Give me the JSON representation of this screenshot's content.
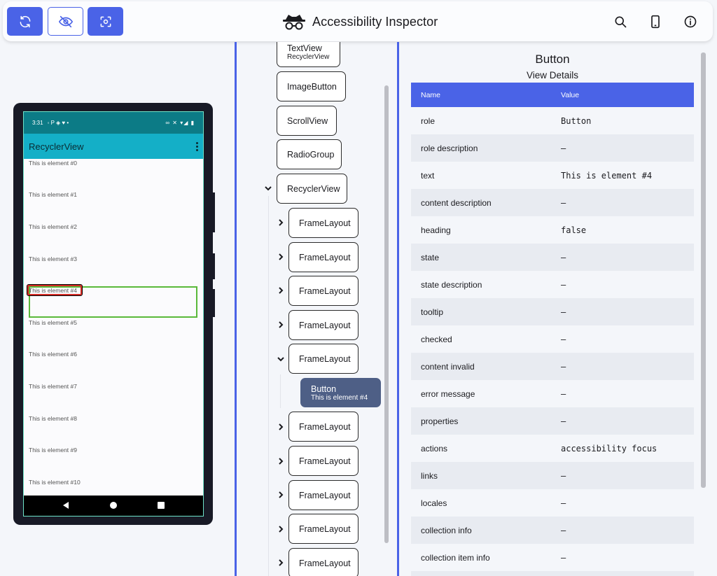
{
  "toolbar": {
    "title": "Accessibility Inspector",
    "buttons": [
      {
        "name": "refresh",
        "icon": "refresh-icon"
      },
      {
        "name": "toggle-visibility",
        "icon": "eye-off-icon"
      },
      {
        "name": "screenshot",
        "icon": "focus-capture-icon"
      }
    ],
    "right_icons": [
      "search-icon",
      "phone-icon",
      "info-icon"
    ],
    "accent": "#4a63e7"
  },
  "device": {
    "status_time": "3:31",
    "app_title": "RecyclerView",
    "elements": [
      "This is element #0",
      "This is element #1",
      "This is element #2",
      "This is element #3",
      "This is element #4",
      "This is element #5",
      "This is element #6",
      "This is element #7",
      "This is element #8",
      "This is element #9",
      "This is element #10"
    ],
    "statusbar_color": "#0c7b86",
    "appbar_color": "#14afc7"
  },
  "tree": {
    "nodes": [
      {
        "label": "TextView",
        "sub": "RecyclerView"
      },
      {
        "label": "ImageButton"
      },
      {
        "label": "ScrollView"
      },
      {
        "label": "RadioGroup"
      },
      {
        "label": "RecyclerView"
      },
      {
        "label": "FrameLayout"
      },
      {
        "label": "FrameLayout"
      },
      {
        "label": "FrameLayout"
      },
      {
        "label": "FrameLayout"
      },
      {
        "label": "FrameLayout"
      },
      {
        "label": "Button",
        "sub": "This is element #4",
        "selected": true
      },
      {
        "label": "FrameLayout"
      },
      {
        "label": "FrameLayout"
      },
      {
        "label": "FrameLayout"
      },
      {
        "label": "FrameLayout"
      },
      {
        "label": "FrameLayout"
      }
    ]
  },
  "details": {
    "title": "Button",
    "subtitle": "View Details",
    "col_name": "Name",
    "col_value": "Value",
    "rows": [
      {
        "name": "role",
        "value": "Button"
      },
      {
        "name": "role description",
        "value": "–"
      },
      {
        "name": "text",
        "value": "This is element #4"
      },
      {
        "name": "content description",
        "value": "–"
      },
      {
        "name": "heading",
        "value": "false"
      },
      {
        "name": "state",
        "value": "–"
      },
      {
        "name": "state description",
        "value": "–"
      },
      {
        "name": "tooltip",
        "value": "–"
      },
      {
        "name": "checked",
        "value": "–"
      },
      {
        "name": "content invalid",
        "value": "–"
      },
      {
        "name": "error message",
        "value": "–"
      },
      {
        "name": "properties",
        "value": "–"
      },
      {
        "name": "actions",
        "value": "accessibility focus"
      },
      {
        "name": "links",
        "value": "–"
      },
      {
        "name": "locales",
        "value": "–"
      },
      {
        "name": "collection info",
        "value": "–"
      },
      {
        "name": "collection item info",
        "value": "–"
      }
    ]
  }
}
